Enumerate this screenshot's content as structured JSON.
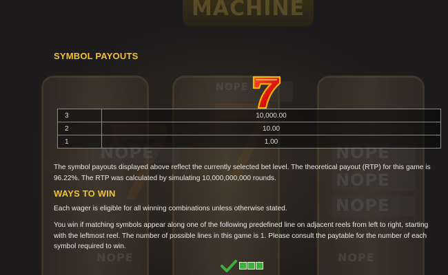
{
  "background": {
    "logo_text": "MACHINE",
    "ghost_symbol_text": "NOPE"
  },
  "symbol_payouts": {
    "title": "SYMBOL PAYOUTS",
    "symbol_icon": "red-seven-icon",
    "rows": [
      {
        "count": "3",
        "value": "10,000.00"
      },
      {
        "count": "2",
        "value": "10.00"
      },
      {
        "count": "1",
        "value": "1.00"
      }
    ],
    "note": "The symbol payouts displayed above reflect the currently selected bet level. The theoretical payout (RTP) for this game is 96.22%. The RTP was calculated by simulating 10,000,000,000 rounds."
  },
  "ways_to_win": {
    "title": "WAYS TO WIN",
    "paragraph_1": "Each wager is eligible for all winning combinations unless otherwise stated.",
    "paragraph_2": "You win if matching symbols appear along one of the following predefined line on adjacent reels from left to right, starting with the leftmost reel. The number of possible lines in this game is 1. Please consult the paytable for the number of each symbol required to win."
  },
  "line_indicator": {
    "icon": "check-icon",
    "colors": {
      "check": "#3fae3f",
      "cell": "#3fae3f",
      "cell_border": "#ffffff"
    }
  },
  "colors": {
    "heading": "#f2c12e",
    "background": "#1d1b1c",
    "text": "#e8e8e8"
  }
}
